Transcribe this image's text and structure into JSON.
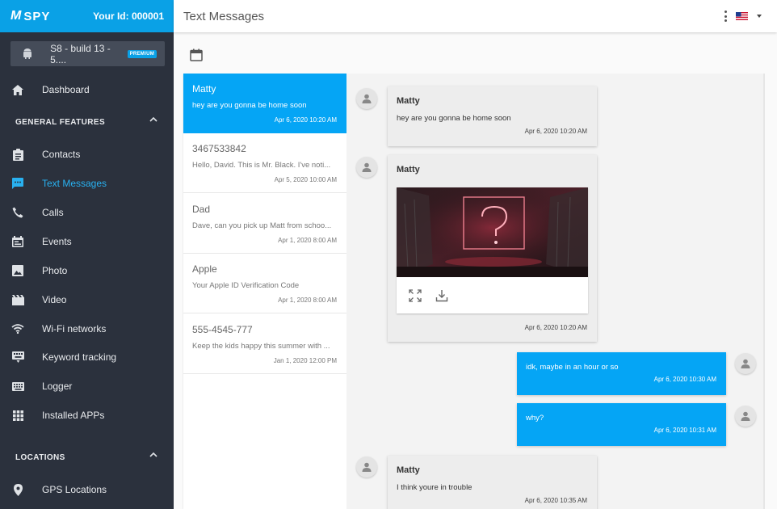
{
  "brand": {
    "logo_text": "SPY",
    "logo_mark": "M",
    "user_id": "Your Id: 000001"
  },
  "device": {
    "name": "S8 - build 13 - 5....",
    "badge": "PREMIUM",
    "icon": "android-icon"
  },
  "sidebar": {
    "top_items": [
      {
        "label": "Dashboard",
        "icon": "home-icon"
      }
    ],
    "general_header": "GENERAL FEATURES",
    "general_items": [
      {
        "label": "Contacts",
        "icon": "contacts-icon"
      },
      {
        "label": "Text Messages",
        "icon": "message-icon"
      },
      {
        "label": "Calls",
        "icon": "phone-icon"
      },
      {
        "label": "Events",
        "icon": "calendar-icon"
      },
      {
        "label": "Photo",
        "icon": "photo-icon"
      },
      {
        "label": "Video",
        "icon": "video-icon"
      },
      {
        "label": "Wi-Fi networks",
        "icon": "wifi-icon"
      },
      {
        "label": "Keyword tracking",
        "icon": "keyboard-icon"
      },
      {
        "label": "Logger",
        "icon": "logger-icon"
      },
      {
        "label": "Installed APPs",
        "icon": "apps-grid-icon"
      }
    ],
    "locations_header": "LOCATIONS",
    "location_items": [
      {
        "label": "GPS Locations",
        "icon": "location-pin-icon"
      }
    ]
  },
  "header": {
    "title": "Text Messages"
  },
  "conversations": [
    {
      "name": "Matty",
      "preview": "hey are you gonna be home soon",
      "time": "Apr 6, 2020 10:20 AM",
      "active": true
    },
    {
      "name": "3467533842",
      "preview": "Hello, David. This is Mr. Black. I've noti...",
      "time": "Apr 5, 2020 10:00 AM"
    },
    {
      "name": "Dad",
      "preview": "Dave, can you pick up Matt from schoo...",
      "time": "Apr 1, 2020 8:00 AM"
    },
    {
      "name": "Apple",
      "preview": "Your Apple ID Verification Code",
      "time": "Apr 1, 2020 8:00 AM"
    },
    {
      "name": "555-4545-777",
      "preview": "Keep the kids happy this summer with ...",
      "time": "Jan 1, 2020 12:00 PM"
    }
  ],
  "messages": [
    {
      "direction": "in",
      "sender": "Matty",
      "text": "hey are you gonna be home soon",
      "time": "Apr 6, 2020 10:20 AM"
    },
    {
      "direction": "in",
      "sender": "Matty",
      "attachment": "image",
      "time": "Apr 6, 2020 10:20 AM"
    },
    {
      "direction": "out",
      "text": "idk, maybe in an hour or so",
      "time": "Apr 6, 2020 10:30 AM"
    },
    {
      "direction": "out",
      "text": "why?",
      "time": "Apr 6, 2020 10:31 AM"
    },
    {
      "direction": "in",
      "sender": "Matty",
      "text": "I think youre in trouble",
      "time": "Apr 6, 2020 10:35 AM"
    }
  ],
  "colors": {
    "accent": "#05a5f5",
    "sidebar_bg": "#2b313d",
    "brand_bar": "#0aa1e6",
    "active_nav": "#29b1f0"
  }
}
